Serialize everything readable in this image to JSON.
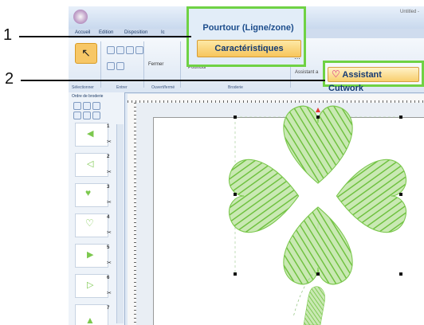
{
  "window": {
    "title": "Untitled -"
  },
  "ribbon": {
    "tabs": [
      "Accueil",
      "Edition",
      "Disposition",
      "Ic"
    ],
    "groups": [
      "Sélectionner",
      "Entrer",
      "Ouvert/fermé",
      "Broderie"
    ],
    "close_label": "Fermer",
    "cutwork_small_label": "Assistant a",
    "outline_small_label": "Pourtour"
  },
  "callouts": {
    "one": {
      "number": "1",
      "pourtour_label": "Pourtour (Ligne/zone)",
      "characteristics_label": "Caractéristiques"
    },
    "two": {
      "number": "2",
      "cutwork_label": "Assistant Cutwork"
    }
  },
  "sidebar": {
    "title": "Ordre de broderie",
    "items": [
      {
        "number": "1"
      },
      {
        "number": "2"
      },
      {
        "number": "3"
      },
      {
        "number": "4"
      },
      {
        "number": "5"
      },
      {
        "number": "6"
      },
      {
        "number": "7"
      }
    ]
  },
  "colors": {
    "stitch_green": "#7cc84e",
    "callout_green": "#6fd244",
    "highlight": "#f7c55c",
    "link_blue": "#1c4d8c"
  },
  "icons": [
    "select-arrow-icon",
    "scissors-icon",
    "heart-icon",
    "cutwork-heart-icon"
  ]
}
